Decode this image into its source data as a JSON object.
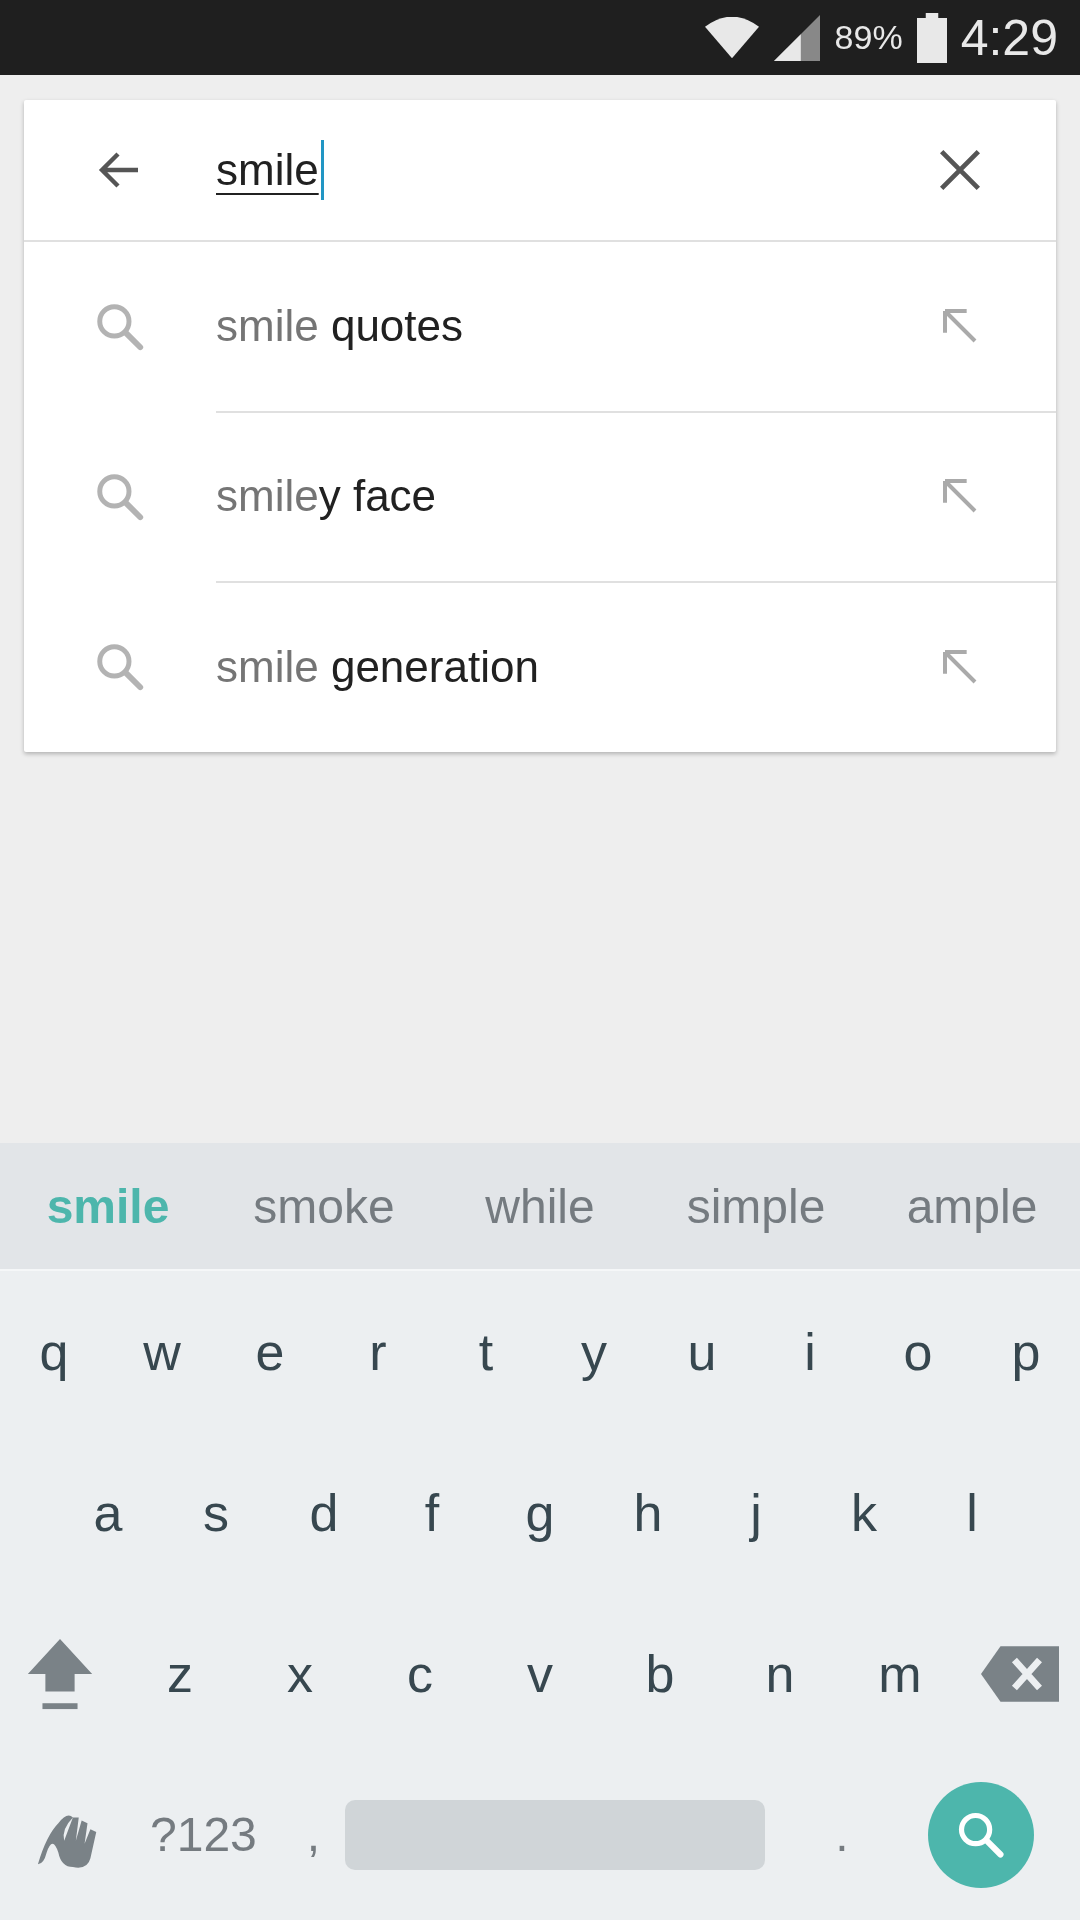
{
  "status_bar": {
    "battery": "89%",
    "time": "4:29"
  },
  "search": {
    "value": "smile"
  },
  "suggestions": [
    {
      "typed": "smile ",
      "completion": "quotes"
    },
    {
      "typed": "smile",
      "completion": "y face"
    },
    {
      "typed": "smile ",
      "completion": "generation"
    }
  ],
  "keyboard": {
    "word_suggestions": [
      {
        "label": "smile",
        "selected": true
      },
      {
        "label": "smoke",
        "selected": false
      },
      {
        "label": "while",
        "selected": false
      },
      {
        "label": "simple",
        "selected": false
      },
      {
        "label": "ample",
        "selected": false
      }
    ],
    "rows": [
      [
        "q",
        "w",
        "e",
        "r",
        "t",
        "y",
        "u",
        "i",
        "o",
        "p"
      ],
      [
        "a",
        "s",
        "d",
        "f",
        "g",
        "h",
        "j",
        "k",
        "l"
      ],
      [
        "z",
        "x",
        "c",
        "v",
        "b",
        "n",
        "m"
      ]
    ],
    "symbols_key": "?123",
    "comma_key": ",",
    "period_key": "."
  }
}
